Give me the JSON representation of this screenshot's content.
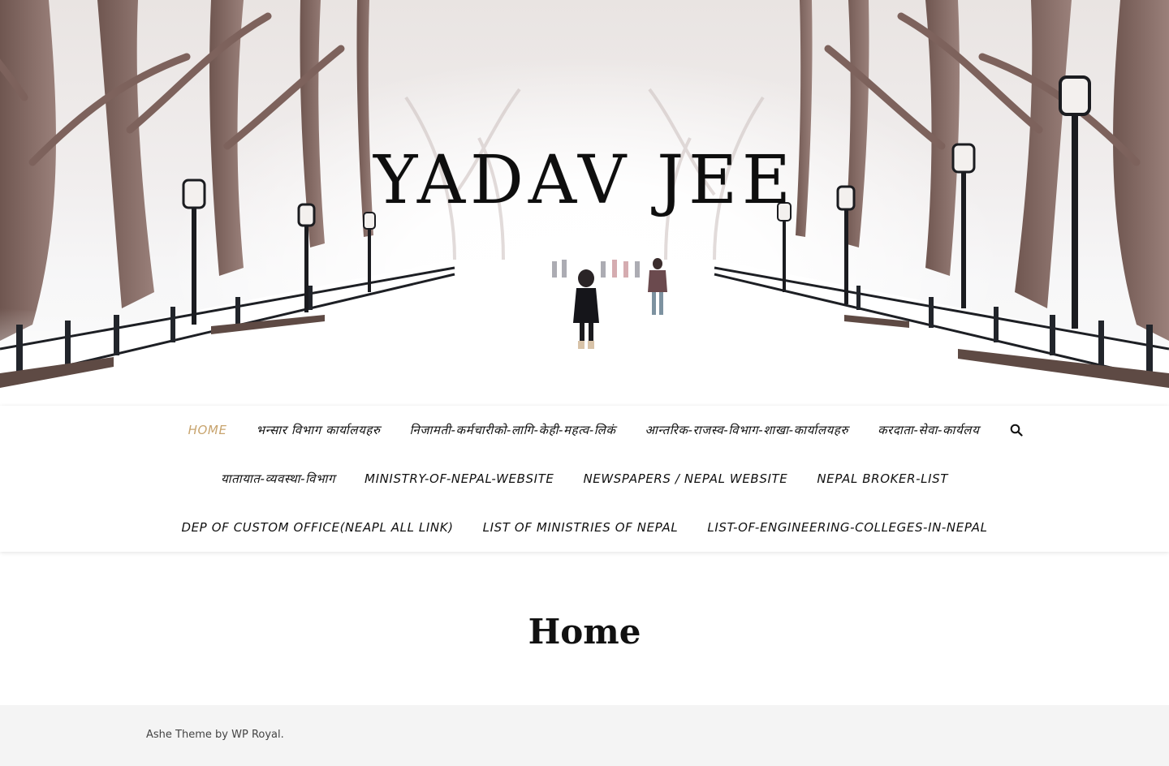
{
  "header": {
    "site_title": "YADAV JEE"
  },
  "nav": {
    "row1": [
      {
        "label": "Home",
        "active": true
      },
      {
        "label": "भन्सार विभाग कार्यालयहरु"
      },
      {
        "label": "निजामती-कर्मचारीको-लागि-केही-महत्व-लिकं"
      },
      {
        "label": "आन्तरिक-राजस्व-विभाग-शाखा-कार्यालयहरु"
      },
      {
        "label": "करदाता-सेवा-कार्यलय"
      }
    ],
    "row2": [
      {
        "label": "यातायात-व्यवस्था-विभाग"
      },
      {
        "label": "ministry-of-nepal-website"
      },
      {
        "label": "Newspapers / Nepal Website"
      },
      {
        "label": "Nepal Broker-List"
      }
    ],
    "row3": [
      {
        "label": "Dep of Custom Office(Neapl All Link)"
      },
      {
        "label": "List of Ministries of Nepal"
      },
      {
        "label": "list-of-engineering-colleges-in-nepal"
      }
    ],
    "search_icon": "search-icon",
    "accent_color": "#c8a46e"
  },
  "main": {
    "page_title": "Home"
  },
  "footer": {
    "theme_name": "Ashe Theme",
    "by": "by",
    "author": "WP Royal",
    "period": "."
  }
}
